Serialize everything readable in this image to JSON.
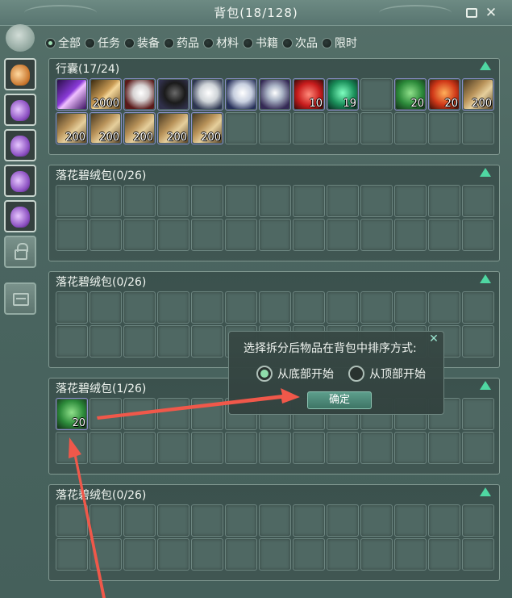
{
  "window": {
    "title": "背包(18/128)"
  },
  "filters": [
    {
      "label": "全部",
      "selected": true
    },
    {
      "label": "任务",
      "selected": false
    },
    {
      "label": "装备",
      "selected": false
    },
    {
      "label": "药品",
      "selected": false
    },
    {
      "label": "材料",
      "selected": false
    },
    {
      "label": "书籍",
      "selected": false
    },
    {
      "label": "次品",
      "selected": false
    },
    {
      "label": "限时",
      "selected": false
    }
  ],
  "sidebar": {
    "bags": [
      "orange-bag-icon",
      "purple-bag-icon",
      "purple-bag-icon",
      "purple-bag-icon",
      "purple-bag-icon"
    ],
    "extra": [
      "lock-icon",
      "storage-chest-icon"
    ]
  },
  "sections": [
    {
      "title": "行囊(17/24)",
      "rows": 2,
      "items": [
        {
          "icon": "purple-blade-icon",
          "qty": ""
        },
        {
          "icon": "scroll-bundle-icon",
          "qty": "2000"
        },
        {
          "icon": "white-horse-red-icon",
          "qty": ""
        },
        {
          "icon": "black-horse-icon",
          "qty": ""
        },
        {
          "icon": "white-horse-icon",
          "qty": ""
        },
        {
          "icon": "white-horse-blue-icon",
          "qty": ""
        },
        {
          "icon": "white-figure-icon",
          "qty": ""
        },
        {
          "icon": "red-fabric-icon",
          "qty": "10"
        },
        {
          "icon": "green-bag-icon",
          "qty": "19"
        },
        {
          "icon": "",
          "qty": ""
        },
        {
          "icon": "green-cloth-icon",
          "qty": "20"
        },
        {
          "icon": "red-cloth-icon",
          "qty": "20"
        },
        {
          "icon": "scroll-icon",
          "qty": "200"
        },
        {
          "icon": "scroll-icon",
          "qty": "200"
        },
        {
          "icon": "scroll-icon",
          "qty": "200"
        },
        {
          "icon": "scroll-icon",
          "qty": "200"
        },
        {
          "icon": "scroll-icon",
          "qty": "200"
        },
        {
          "icon": "scroll-icon",
          "qty": "200"
        }
      ]
    },
    {
      "title": "落花碧绒包(0/26)",
      "rows": 2,
      "items": []
    },
    {
      "title": "落花碧绒包(0/26)",
      "rows": 2,
      "items": []
    },
    {
      "title": "落花碧绒包(1/26)",
      "rows": 2,
      "items": [
        {
          "icon": "green-cloth-icon",
          "qty": "20"
        }
      ]
    },
    {
      "title": "落花碧绒包(0/26)",
      "rows": 2,
      "items": []
    }
  ],
  "dialog": {
    "prompt": "选择拆分后物品在背包中排序方式:",
    "option_bottom": "从底部开始",
    "option_top": "从顶部开始",
    "selected": "bottom",
    "confirm_label": "确定"
  },
  "colors": {
    "accent": "#4fd7a2",
    "annotation_arrow": "#f0584a"
  }
}
